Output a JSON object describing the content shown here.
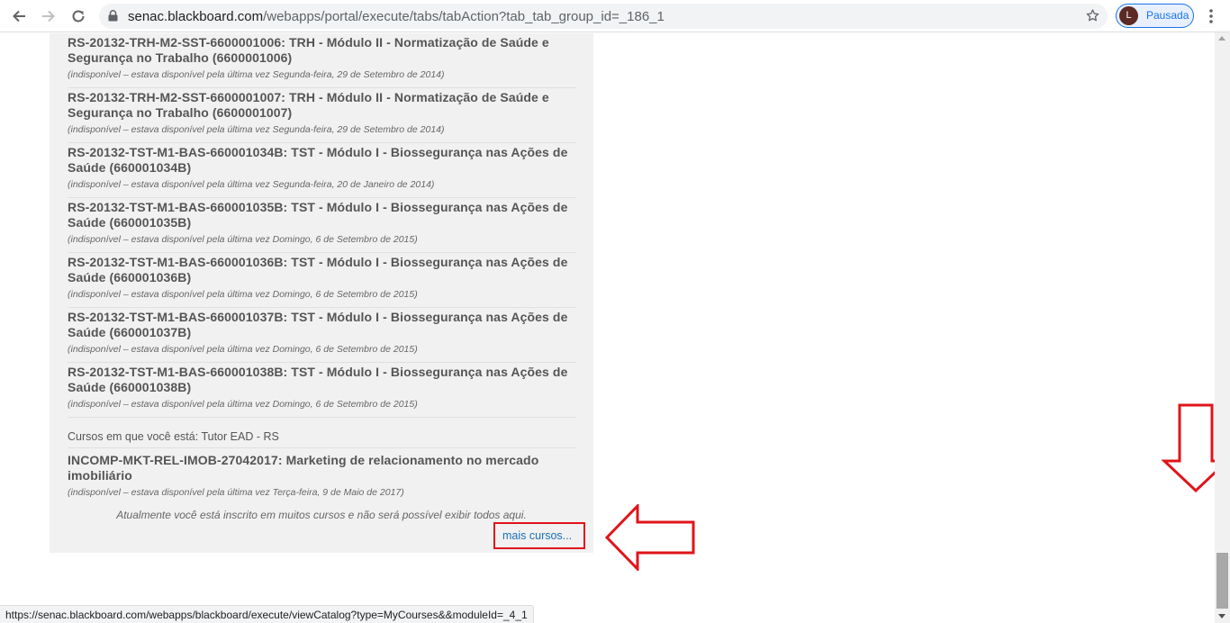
{
  "browser": {
    "url_host": "senac.blackboard.com",
    "url_path": "/webapps/portal/execute/tabs/tabAction?tab_tab_group_id=_186_1",
    "profile_initial": "L",
    "profile_label": "Pausada",
    "status_url": "https://senac.blackboard.com/webapps/blackboard/execute/viewCatalog?type=MyCourses&&moduleId=_4_1"
  },
  "courses": [
    {
      "title": "RS-20132-TRH-M2-SST-6600001006: TRH - Módulo II - Normatização de Saúde e Segurança no Trabalho (6600001006)",
      "status": "(indisponível – estava disponível pela última vez Segunda-feira, 29 de Setembro de 2014)"
    },
    {
      "title": "RS-20132-TRH-M2-SST-6600001007: TRH - Módulo II - Normatização de Saúde e Segurança no Trabalho (6600001007)",
      "status": "(indisponível – estava disponível pela última vez Segunda-feira, 29 de Setembro de 2014)"
    },
    {
      "title": "RS-20132-TST-M1-BAS-660001034B: TST - Módulo I - Biossegurança nas Ações de Saúde (660001034B)",
      "status": "(indisponível – estava disponível pela última vez Segunda-feira, 20 de Janeiro de 2014)"
    },
    {
      "title": "RS-20132-TST-M1-BAS-660001035B: TST - Módulo I - Biossegurança nas Ações de Saúde (660001035B)",
      "status": "(indisponível – estava disponível pela última vez Domingo, 6 de Setembro de 2015)"
    },
    {
      "title": "RS-20132-TST-M1-BAS-660001036B: TST - Módulo I - Biossegurança nas Ações de Saúde (660001036B)",
      "status": "(indisponível – estava disponível pela última vez Domingo, 6 de Setembro de 2015)"
    },
    {
      "title": "RS-20132-TST-M1-BAS-660001037B: TST - Módulo I - Biossegurança nas Ações de Saúde (660001037B)",
      "status": "(indisponível – estava disponível pela última vez Domingo, 6 de Setembro de 2015)"
    },
    {
      "title": "RS-20132-TST-M1-BAS-660001038B: TST - Módulo I - Biossegurança nas Ações de Saúde (660001038B)",
      "status": "(indisponível – estava disponível pela última vez Domingo, 6 de Setembro de 2015)"
    }
  ],
  "tutor_section": {
    "label": "Cursos em que você está: Tutor EAD - RS",
    "course_title": "INCOMP-MKT-REL-IMOB-27042017: Marketing de relacionamento no mercado imobiliário",
    "course_status": "(indisponível – estava disponível pela última vez Terça-feira, 9 de Maio de 2017)"
  },
  "notice": "Atualmente você está inscrito em muitos cursos e não será possível exibir todos aqui.",
  "more_link": "mais cursos...",
  "colors": {
    "annotation_red": "#e0141a",
    "link_blue": "#1a6fb8"
  }
}
